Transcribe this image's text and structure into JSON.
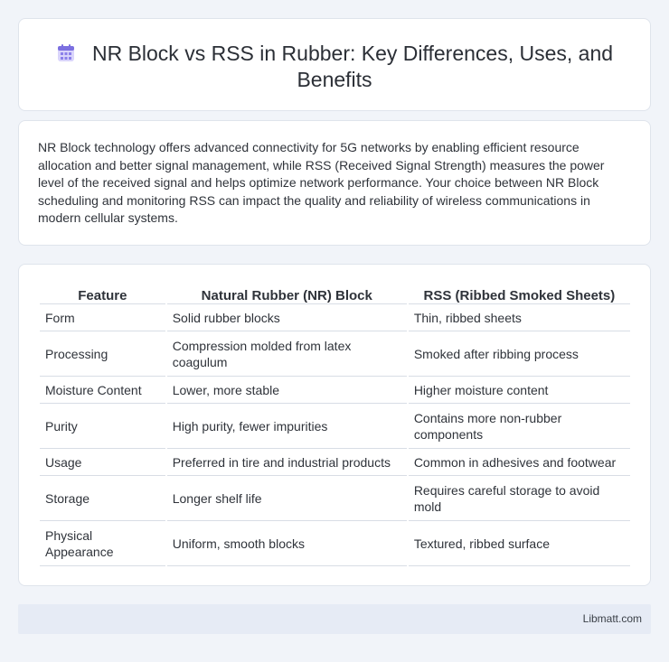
{
  "header": {
    "title": "NR Block vs RSS in Rubber: Key Differences, Uses, and Benefits",
    "icon": "calendar-icon",
    "icon_color": "#7b6fe0"
  },
  "intro": {
    "text": "NR Block technology offers advanced connectivity for 5G networks by enabling efficient resource allocation and better signal management, while RSS (Received Signal Strength) measures the power level of the received signal and helps optimize network performance. Your choice between NR Block scheduling and monitoring RSS can impact the quality and reliability of wireless communications in modern cellular systems."
  },
  "table": {
    "headers": [
      "Feature",
      "Natural Rubber (NR) Block",
      "RSS (Ribbed Smoked Sheets)"
    ],
    "rows": [
      [
        "Form",
        "Solid rubber blocks",
        "Thin, ribbed sheets"
      ],
      [
        "Processing",
        "Compression molded from latex coagulum",
        "Smoked after ribbing process"
      ],
      [
        "Moisture Content",
        "Lower, more stable",
        "Higher moisture content"
      ],
      [
        "Purity",
        "High purity, fewer impurities",
        "Contains more non-rubber components"
      ],
      [
        "Usage",
        "Preferred in tire and industrial products",
        "Common in adhesives and footwear"
      ],
      [
        "Storage",
        "Longer shelf life",
        "Requires careful storage to avoid mold"
      ],
      [
        "Physical Appearance",
        "Uniform, smooth blocks",
        "Textured, ribbed surface"
      ]
    ]
  },
  "footer": {
    "site": "Libmatt.com"
  }
}
